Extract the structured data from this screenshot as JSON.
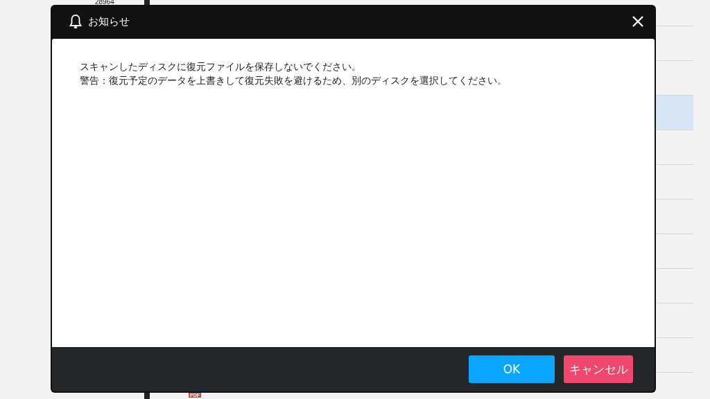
{
  "background": {
    "top_number": "28964",
    "file_badge": "PDF",
    "list_rows": [
      {
        "selected": false
      },
      {
        "selected": false
      },
      {
        "selected": false
      },
      {
        "selected": true
      },
      {
        "selected": false
      },
      {
        "selected": false
      },
      {
        "selected": false
      },
      {
        "selected": false
      },
      {
        "selected": false
      },
      {
        "selected": false
      },
      {
        "selected": false
      }
    ]
  },
  "dialog": {
    "title": "お知らせ",
    "message": [
      "スキャンしたディスクに復元ファイルを保存しないでください。",
      "警告：復元予定のデータを上書きして復元失敗を避けるため、別のディスクを選択してください。"
    ],
    "buttons": [
      {
        "label": "OK",
        "kind": "primary"
      },
      {
        "label": "キャンセル",
        "kind": "cancel"
      }
    ]
  }
}
